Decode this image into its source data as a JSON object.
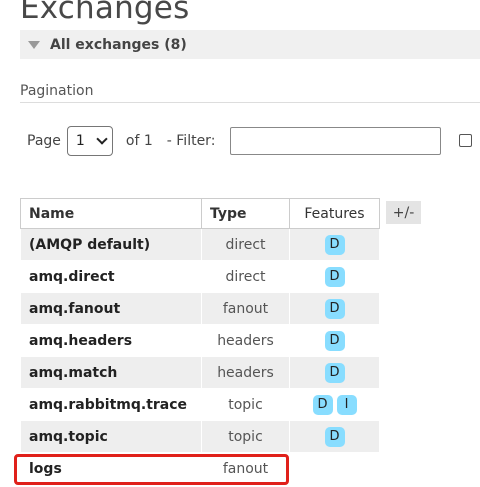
{
  "page": {
    "title": "Exchanges"
  },
  "section": {
    "label": "All exchanges (8)"
  },
  "pagination": {
    "label": "Pagination",
    "page_label": "Page",
    "page_value": "1",
    "of_label": "of 1",
    "filter_label": "- Filter:",
    "filter_value": ""
  },
  "table": {
    "headers": {
      "name": "Name",
      "type": "Type",
      "features": "Features"
    },
    "rows": [
      {
        "name": "(AMQP default)",
        "type": "direct",
        "features": [
          "D"
        ]
      },
      {
        "name": "amq.direct",
        "type": "direct",
        "features": [
          "D"
        ]
      },
      {
        "name": "amq.fanout",
        "type": "fanout",
        "features": [
          "D"
        ]
      },
      {
        "name": "amq.headers",
        "type": "headers",
        "features": [
          "D"
        ]
      },
      {
        "name": "amq.match",
        "type": "headers",
        "features": [
          "D"
        ]
      },
      {
        "name": "amq.rabbitmq.trace",
        "type": "topic",
        "features": [
          "D",
          "I"
        ]
      },
      {
        "name": "amq.topic",
        "type": "topic",
        "features": [
          "D"
        ]
      },
      {
        "name": "logs",
        "type": "fanout",
        "features": []
      }
    ],
    "columns_toggle": "+/-"
  },
  "colors": {
    "feature_badge": "#88ddff",
    "highlight": "#e0201a",
    "row_alt": "#eeeeee"
  }
}
